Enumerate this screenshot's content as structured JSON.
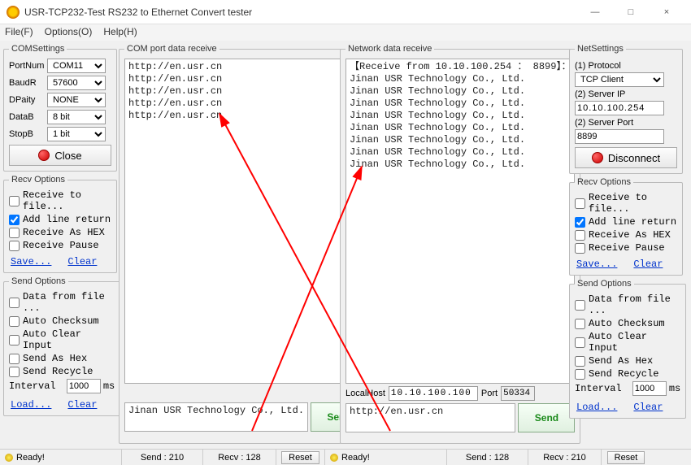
{
  "window": {
    "title": "USR-TCP232-Test  RS232 to Ethernet Convert tester",
    "min": "—",
    "max": "□",
    "close": "×"
  },
  "menu": {
    "file": "File(F)",
    "options": "Options(O)",
    "help": "Help(H)"
  },
  "com_settings": {
    "legend": "COMSettings",
    "portnum_label": "PortNum",
    "portnum": "COM11",
    "baud_label": "BaudR",
    "baud": "57600",
    "dparity_label": "DPaity",
    "dparity": "NONE",
    "datab_label": "DataB",
    "datab": "8 bit",
    "stopb_label": "StopB",
    "stopb": "1 bit",
    "close": "Close"
  },
  "recv_options_left": {
    "legend": "Recv Options",
    "to_file": "Receive to file...",
    "add_line": "Add line return",
    "as_hex": "Receive As HEX",
    "pause": "Receive Pause",
    "save": "Save...",
    "clear": "Clear"
  },
  "send_options_left": {
    "legend": "Send Options",
    "from_file": "Data from file ...",
    "checksum": "Auto Checksum",
    "clear_input": "Auto Clear Input",
    "as_hex": "Send As Hex",
    "recycle": "Send Recycle",
    "interval_label": "Interval",
    "interval": "1000",
    "ms": "ms",
    "load": "Load...",
    "clear": "Clear"
  },
  "com_recv": {
    "legend": "COM port data receive",
    "text": "http://en.usr.cn\nhttp://en.usr.cn\nhttp://en.usr.cn\nhttp://en.usr.cn\nhttp://en.usr.cn",
    "send_text": "Jinan USR Technology Co., Ltd.",
    "send_btn": "Send"
  },
  "net_recv": {
    "legend": "Network data receive",
    "text": "【Receive from 10.10.100.254 ： 8899】：\nJinan USR Technology Co., Ltd.\nJinan USR Technology Co., Ltd.\nJinan USR Technology Co., Ltd.\nJinan USR Technology Co., Ltd.\nJinan USR Technology Co., Ltd.\nJinan USR Technology Co., Ltd.\nJinan USR Technology Co., Ltd.\nJinan USR Technology Co., Ltd.",
    "localhost_label": "LocalHost",
    "localhost": "10.10.100.100",
    "port_label": "Port",
    "port": "50334",
    "send_text": "http://en.usr.cn",
    "send_btn": "Send"
  },
  "net_settings": {
    "legend": "NetSettings",
    "protocol_label": "(1) Protocol",
    "protocol": "TCP Client",
    "serverip_label": "(2) Server IP",
    "serverip": "10.10.100.254",
    "serverport_label": "(2) Server Port",
    "serverport": "8899",
    "disconnect": "Disconnect"
  },
  "recv_options_right": {
    "legend": "Recv Options",
    "to_file": "Receive to file...",
    "add_line": "Add line return",
    "as_hex": "Receive As HEX",
    "pause": "Receive Pause",
    "save": "Save...",
    "clear": "Clear"
  },
  "send_options_right": {
    "legend": "Send Options",
    "from_file": "Data from file ...",
    "checksum": "Auto Checksum",
    "clear_input": "Auto Clear Input",
    "as_hex": "Send As Hex",
    "recycle": "Send Recycle",
    "interval_label": "Interval",
    "interval": "1000",
    "ms": "ms",
    "load": "Load...",
    "clear": "Clear"
  },
  "status": {
    "ready1": "Ready!",
    "send1": "Send : 210",
    "recv1": "Recv : 128",
    "reset1": "Reset",
    "ready2": "Ready!",
    "send2": "Send : 128",
    "recv2": "Recv : 210",
    "reset2": "Reset"
  }
}
